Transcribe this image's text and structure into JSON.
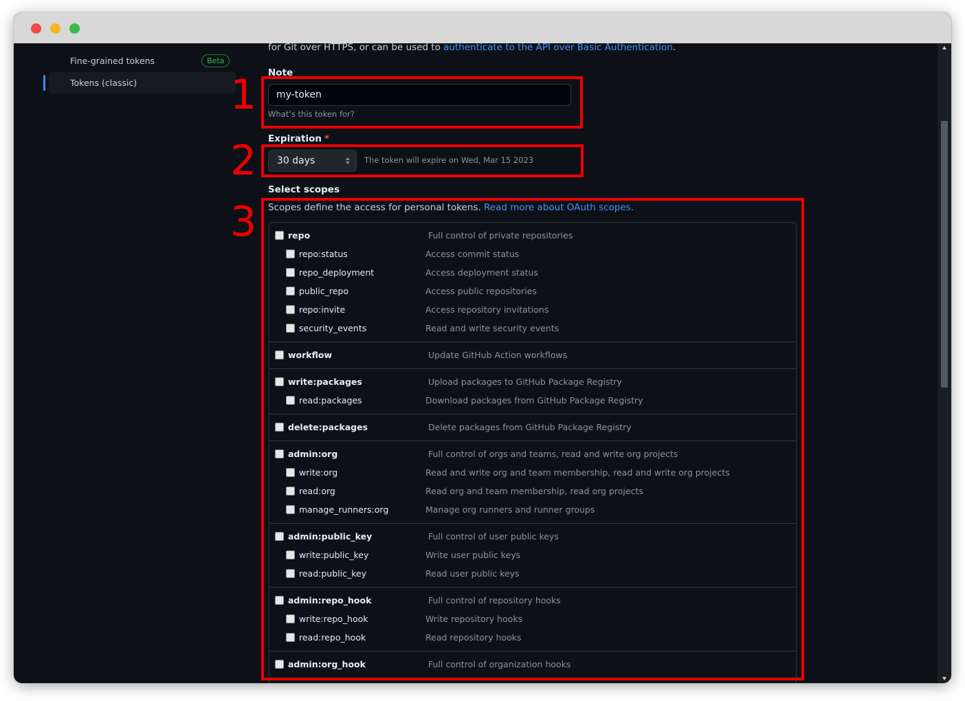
{
  "sidebar": {
    "items": [
      {
        "label": "Fine-grained tokens",
        "badge": "Beta"
      },
      {
        "label": "Tokens (classic)"
      }
    ]
  },
  "intro": {
    "prefix": "for Git over HTTPS, or can be used to ",
    "link": "authenticate to the API over Basic Authentication",
    "suffix": "."
  },
  "note": {
    "label": "Note",
    "value": "my-token",
    "hint": "What’s this token for?"
  },
  "expiration": {
    "label": "Expiration",
    "required_mark": "*",
    "selected": "30 days",
    "hint": "The token will expire on Wed, Mar 15 2023"
  },
  "scopes": {
    "label": "Select scopes",
    "description": "Scopes define the access for personal tokens. ",
    "link": "Read more about OAuth scopes."
  },
  "annotations": [
    "1",
    "2",
    "3"
  ],
  "colors": {
    "annotation": "#ee0000",
    "link": "#4493f8",
    "background": "#0d1117"
  }
}
